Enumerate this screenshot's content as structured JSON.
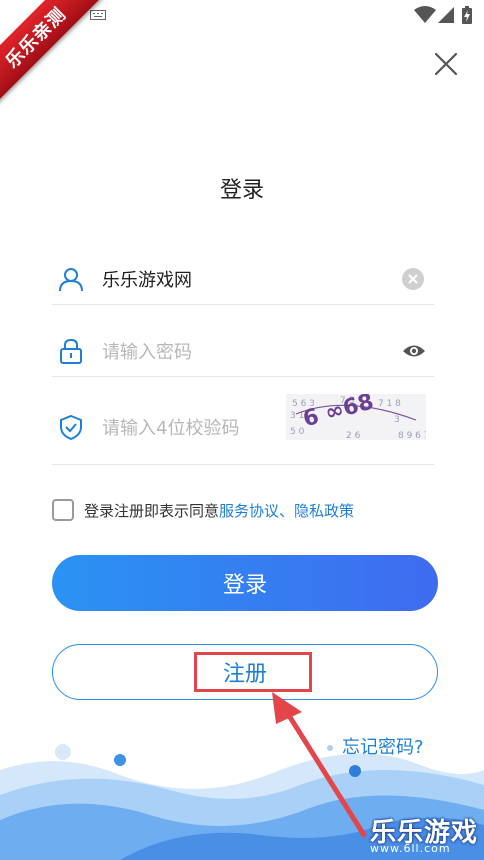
{
  "watermark": {
    "text": "乐乐亲测"
  },
  "page": {
    "title": "登录"
  },
  "form": {
    "username": {
      "value": "乐乐游戏网"
    },
    "password": {
      "placeholder": "请输入密码"
    },
    "captcha": {
      "placeholder": "请输入4位校验码",
      "image_text": "6 ∞68"
    }
  },
  "agreement": {
    "text": "登录注册即表示同意",
    "terms_link": "服务协议",
    "separator": "、",
    "privacy_link": "隐私政策",
    "checked": false
  },
  "buttons": {
    "login": "登录",
    "register": "注册"
  },
  "links": {
    "forgot_password": "忘记密码?"
  },
  "brand": {
    "name": "乐乐游戏",
    "url": "www.6ll.com"
  },
  "colors": {
    "accent": "#1f7fd8",
    "highlight": "#e2454a",
    "ribbon": "#e2232a"
  }
}
